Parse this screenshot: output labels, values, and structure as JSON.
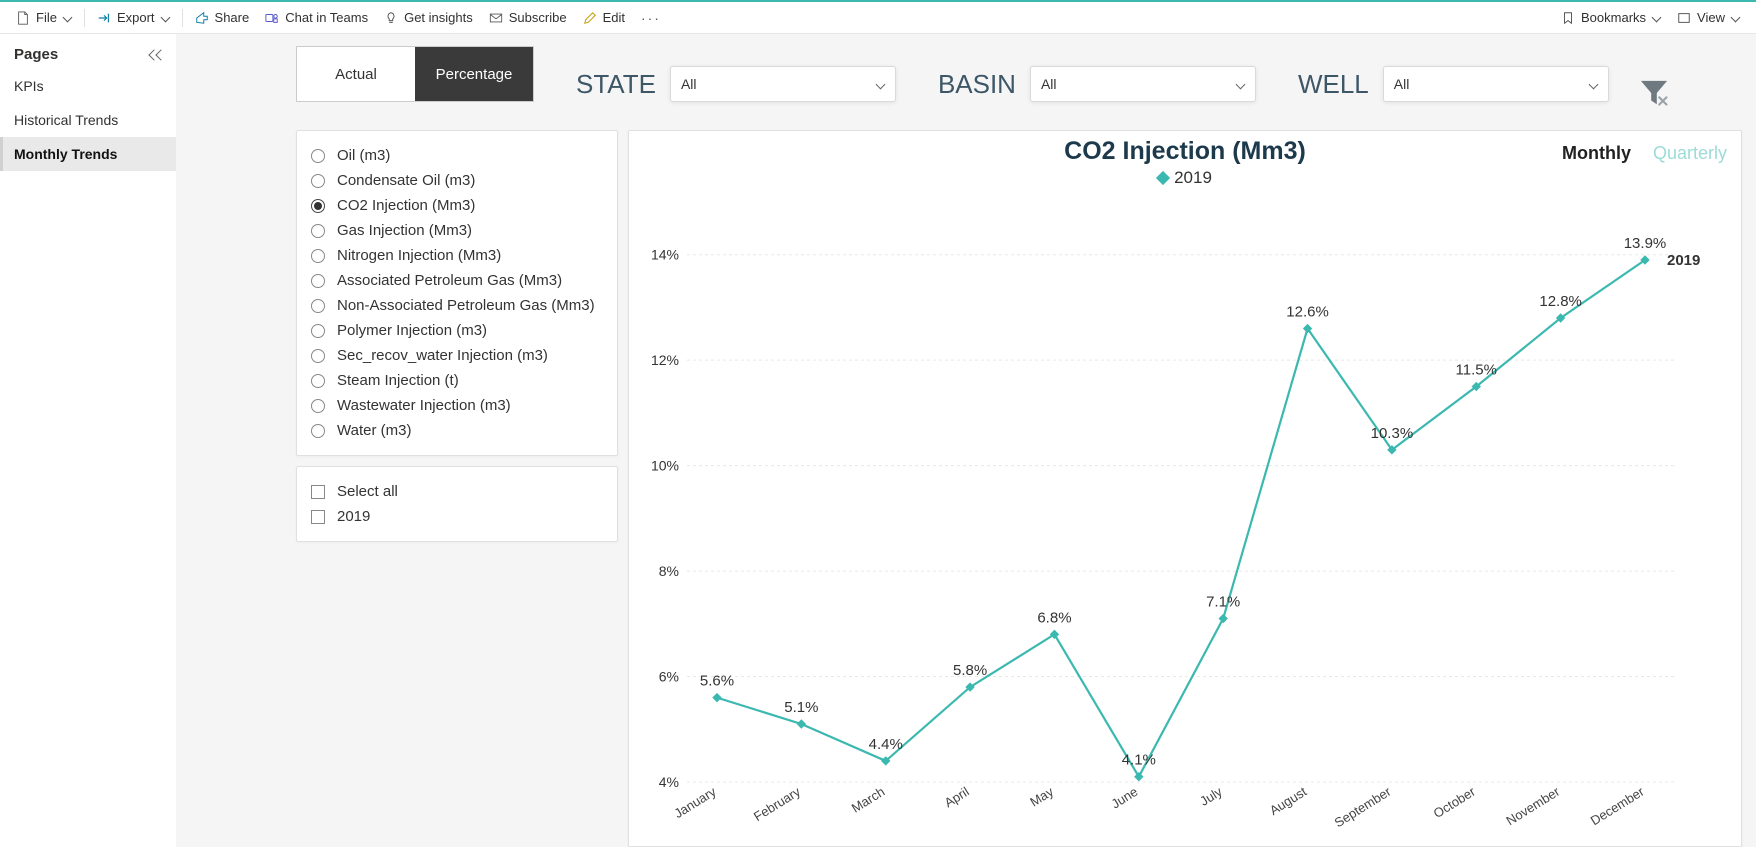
{
  "toolbar": {
    "file": "File",
    "export": "Export",
    "share": "Share",
    "chat": "Chat in Teams",
    "insights": "Get insights",
    "subscribe": "Subscribe",
    "edit": "Edit",
    "bookmarks": "Bookmarks",
    "view": "View"
  },
  "pages": {
    "title": "Pages",
    "items": [
      {
        "label": "KPIs",
        "active": false
      },
      {
        "label": "Historical Trends",
        "active": false
      },
      {
        "label": "Monthly Trends",
        "active": true
      }
    ]
  },
  "segment": {
    "actual": "Actual",
    "percentage": "Percentage"
  },
  "filters": {
    "state": {
      "label": "STATE",
      "value": "All"
    },
    "basin": {
      "label": "BASIN",
      "value": "All"
    },
    "well": {
      "label": "WELL",
      "value": "All"
    }
  },
  "metrics": [
    {
      "label": "Oil (m3)",
      "selected": false
    },
    {
      "label": "Condensate Oil (m3)",
      "selected": false
    },
    {
      "label": "CO2 Injection (Mm3)",
      "selected": true
    },
    {
      "label": "Gas Injection (Mm3)",
      "selected": false
    },
    {
      "label": "Nitrogen Injection (Mm3)",
      "selected": false
    },
    {
      "label": "Associated Petroleum Gas (Mm3)",
      "selected": false
    },
    {
      "label": "Non-Associated Petroleum Gas (Mm3)",
      "selected": false
    },
    {
      "label": "Polymer Injection (m3)",
      "selected": false
    },
    {
      "label": "Sec_recov_water Injection (m3)",
      "selected": false
    },
    {
      "label": "Steam Injection (t)",
      "selected": false
    },
    {
      "label": "Wastewater Injection (m3)",
      "selected": false
    },
    {
      "label": "Water (m3)",
      "selected": false
    }
  ],
  "year_filter": {
    "select_all": "Select all",
    "items": [
      "2019"
    ]
  },
  "chart": {
    "title": "CO2 Injection (Mm3)",
    "legend": "2019",
    "view_monthly": "Monthly",
    "view_quarterly": "Quarterly",
    "end_label": "2019"
  },
  "chart_data": {
    "type": "line",
    "title": "CO2 Injection (Mm3)",
    "xlabel": "",
    "ylabel": "",
    "ylim": [
      4,
      15
    ],
    "yticks": [
      4,
      6,
      8,
      10,
      12,
      14
    ],
    "yticks_label": [
      "4%",
      "6%",
      "8%",
      "10%",
      "12%",
      "14%"
    ],
    "categories": [
      "January",
      "February",
      "March",
      "April",
      "May",
      "June",
      "July",
      "August",
      "September",
      "October",
      "November",
      "December"
    ],
    "series": [
      {
        "name": "2019",
        "values": [
          5.6,
          5.1,
          4.4,
          5.8,
          6.8,
          4.1,
          7.1,
          12.6,
          10.3,
          11.5,
          12.8,
          13.9
        ],
        "color": "#3bb8af"
      }
    ],
    "value_suffix": "%"
  }
}
